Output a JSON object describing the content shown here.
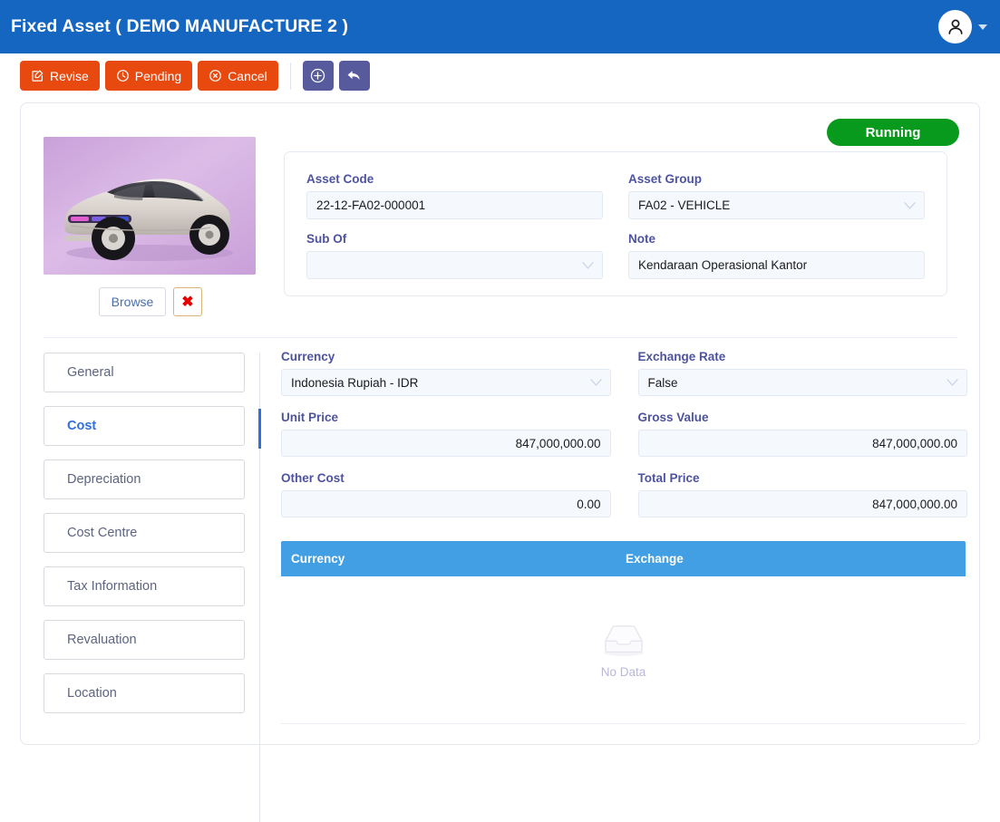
{
  "header": {
    "title": "Fixed Asset ( DEMO MANUFACTURE 2 )",
    "avatar_icon": "user-icon",
    "caret_icon": "chevron-down-icon",
    "bg_color": "#1566c0"
  },
  "toolbar": {
    "revise_label": "Revise",
    "revise_icon": "edit-square-icon",
    "pending_label": "Pending",
    "pending_icon": "clock-icon",
    "cancel_label": "Cancel",
    "cancel_icon": "close-circle-icon",
    "add_icon": "plus-circle-icon",
    "back_icon": "undo-arrow-icon",
    "orange_color": "#e8490f",
    "slate_color": "#575b9e"
  },
  "status": {
    "label": "Running",
    "color": "#089a1d"
  },
  "thumbnail": {
    "alt": "silver electric suv on purple background",
    "browse_label": "Browse",
    "delete_icon": "red-x-icon",
    "delete_glyph": "✖"
  },
  "asset_panel": {
    "fields": [
      {
        "label": "Asset Code",
        "value": "22-12-FA02-000001",
        "type": "text",
        "placeholder": ""
      },
      {
        "label": "Asset Group",
        "value": "FA02 - VEHICLE",
        "type": "select",
        "placeholder": ""
      },
      {
        "label": "Sub Of",
        "value": "",
        "type": "select",
        "placeholder": ""
      },
      {
        "label": "Note",
        "value": "Kendaraan Operasional Kantor",
        "type": "text",
        "placeholder": ""
      }
    ]
  },
  "tabs": {
    "items": [
      {
        "label": "General",
        "active": false
      },
      {
        "label": "Cost",
        "active": true
      },
      {
        "label": "Depreciation",
        "active": false
      },
      {
        "label": "Cost Centre",
        "active": false
      },
      {
        "label": "Tax Information",
        "active": false
      },
      {
        "label": "Revaluation",
        "active": false
      },
      {
        "label": "Location",
        "active": false
      }
    ],
    "active_color": "#2f6fe0"
  },
  "cost_pane": {
    "fields": [
      {
        "label": "Currency",
        "value": "Indonesia Rupiah - IDR",
        "type": "select"
      },
      {
        "label": "Exchange Rate",
        "value": "False",
        "type": "select"
      },
      {
        "label": "Unit Price",
        "value": "847,000,000.00",
        "type": "number"
      },
      {
        "label": "Gross Value",
        "value": "847,000,000.00",
        "type": "number"
      },
      {
        "label": "Other Cost",
        "value": "0.00",
        "type": "number"
      },
      {
        "label": "Total Price",
        "value": "847,000,000.00",
        "type": "number"
      }
    ],
    "table": {
      "header_color": "#429fe3",
      "columns": [
        "Currency",
        "Exchange"
      ],
      "rows": [],
      "empty_text": "No Data",
      "empty_icon": "empty-inbox-icon"
    }
  }
}
